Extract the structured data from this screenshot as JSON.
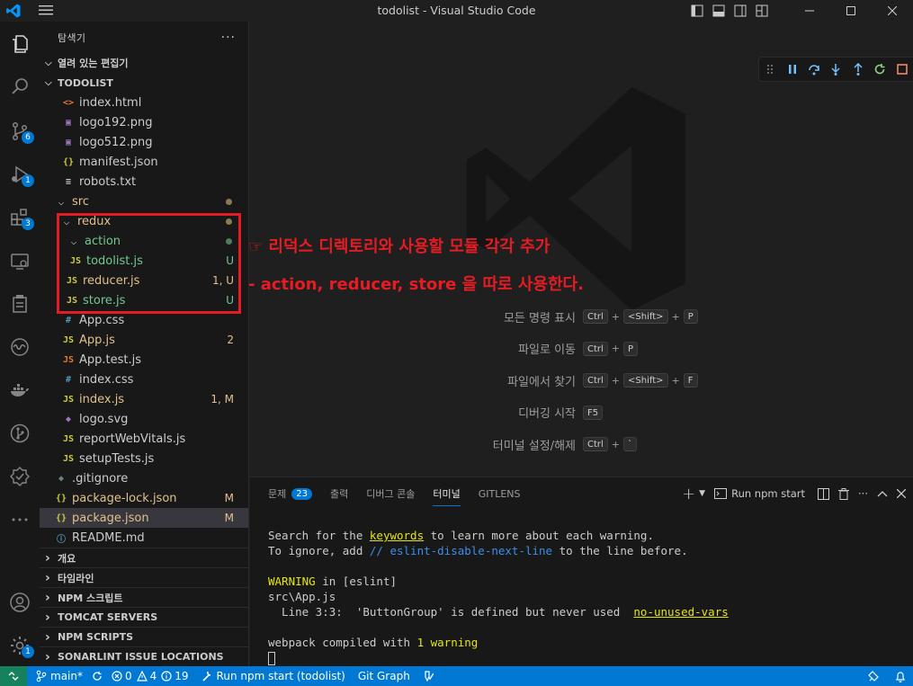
{
  "window": {
    "title": "todolist - Visual Studio Code"
  },
  "activity_bar": {
    "items": [
      {
        "name": "explorer",
        "badge": ""
      },
      {
        "name": "search",
        "badge": ""
      },
      {
        "name": "source-control",
        "badge": "6"
      },
      {
        "name": "run-debug",
        "badge": "1"
      },
      {
        "name": "extensions",
        "badge": "3"
      },
      {
        "name": "remote-explorer",
        "badge": ""
      },
      {
        "name": "testing",
        "badge": ""
      },
      {
        "name": "timeline-wave",
        "badge": ""
      },
      {
        "name": "docker",
        "badge": ""
      },
      {
        "name": "git-graph",
        "badge": ""
      },
      {
        "name": "sonarlint",
        "badge": ""
      },
      {
        "name": "more",
        "badge": ""
      }
    ],
    "accounts_badge": "",
    "settings_badge": "1"
  },
  "sidebar": {
    "header": "탐색기",
    "open_editors": "열려 있는 편집기",
    "project": "TODOLIST",
    "files": [
      {
        "label": "index.html",
        "icon": "<>",
        "color": "#e37933",
        "indent": 1,
        "status": "",
        "label_class": ""
      },
      {
        "label": "logo192.png",
        "icon": "▣",
        "color": "#a074c4",
        "indent": 1,
        "status": "",
        "label_class": ""
      },
      {
        "label": "logo512.png",
        "icon": "▣",
        "color": "#a074c4",
        "indent": 1,
        "status": "",
        "label_class": ""
      },
      {
        "label": "manifest.json",
        "icon": "{}",
        "color": "#cbcb41",
        "indent": 1,
        "status": "",
        "label_class": ""
      },
      {
        "label": "robots.txt",
        "icon": "≡",
        "color": "#cccccc",
        "indent": 1,
        "status": "",
        "label_class": ""
      },
      {
        "label": "src",
        "icon": "chev-down",
        "color": "#cccccc",
        "indent": 0,
        "status": "dot-mod",
        "label_class": "c-mod"
      },
      {
        "label": "redux",
        "icon": "chev-down",
        "color": "#cccccc",
        "indent": 1,
        "status": "dot-mod",
        "label_class": "c-mod"
      },
      {
        "label": "action",
        "icon": "chev-down",
        "color": "#cccccc",
        "indent": 2,
        "status": "dot-new",
        "label_class": "c-new"
      },
      {
        "label": "todolist.js",
        "icon": "JS",
        "color": "#cbcb41",
        "indent": 3,
        "status": "U",
        "label_class": "c-new"
      },
      {
        "label": "reducer.js",
        "icon": "JS",
        "color": "#cbcb41",
        "indent": 2,
        "status": "1, U",
        "label_class": "c-err"
      },
      {
        "label": "store.js",
        "icon": "JS",
        "color": "#cbcb41",
        "indent": 2,
        "status": "U",
        "label_class": "c-new"
      },
      {
        "label": "App.css",
        "icon": "#",
        "color": "#519aba",
        "indent": 1,
        "status": "",
        "label_class": ""
      },
      {
        "label": "App.js",
        "icon": "JS",
        "color": "#cbcb41",
        "indent": 1,
        "status": "2",
        "label_class": "c-err"
      },
      {
        "label": "App.test.js",
        "icon": "JS",
        "color": "#e37933",
        "indent": 1,
        "status": "",
        "label_class": ""
      },
      {
        "label": "index.css",
        "icon": "#",
        "color": "#519aba",
        "indent": 1,
        "status": "",
        "label_class": ""
      },
      {
        "label": "index.js",
        "icon": "JS",
        "color": "#cbcb41",
        "indent": 1,
        "status": "1, M",
        "label_class": "c-err"
      },
      {
        "label": "logo.svg",
        "icon": "◆",
        "color": "#a074c4",
        "indent": 1,
        "status": "",
        "label_class": ""
      },
      {
        "label": "reportWebVitals.js",
        "icon": "JS",
        "color": "#cbcb41",
        "indent": 1,
        "status": "",
        "label_class": ""
      },
      {
        "label": "setupTests.js",
        "icon": "JS",
        "color": "#cbcb41",
        "indent": 1,
        "status": "",
        "label_class": ""
      },
      {
        "label": ".gitignore",
        "icon": "◆",
        "color": "#6d8086",
        "indent": 0,
        "status": "",
        "label_class": ""
      },
      {
        "label": "package-lock.json",
        "icon": "{}",
        "color": "#cbcb41",
        "indent": 0,
        "status": "M",
        "label_class": "c-mod"
      },
      {
        "label": "package.json",
        "icon": "{}",
        "color": "#cbcb41",
        "indent": 0,
        "status": "M",
        "label_class": "c-mod",
        "selected": true
      },
      {
        "label": "README.md",
        "icon": "ⓘ",
        "color": "#519aba",
        "indent": 0,
        "status": "",
        "label_class": ""
      }
    ],
    "sections": [
      "개요",
      "타임라인",
      "NPM 스크립트",
      "TOMCAT SERVERS",
      "NPM SCRIPTS",
      "SONARLINT ISSUE LOCATIONS"
    ]
  },
  "annotation": {
    "line1": "☞ 리덕스 디렉토리와 사용할 모듈 각각 추가",
    "line2": "- action, reducer, store 을 따로 사용한다."
  },
  "shortcuts": [
    {
      "label": "모든 명령 표시",
      "keys": [
        "Ctrl",
        "<Shift>",
        "P"
      ]
    },
    {
      "label": "파일로 이동",
      "keys": [
        "Ctrl",
        "P"
      ]
    },
    {
      "label": "파일에서 찾기",
      "keys": [
        "Ctrl",
        "<Shift>",
        "F"
      ]
    },
    {
      "label": "디버깅 시작",
      "keys": [
        "F5"
      ]
    },
    {
      "label": "터미널 설정/해제",
      "keys": [
        "Ctrl",
        "`"
      ]
    }
  ],
  "panel": {
    "tabs": [
      {
        "label": "문제",
        "badge": "23",
        "active": false
      },
      {
        "label": "출력",
        "badge": "",
        "active": false
      },
      {
        "label": "디버그 콘솔",
        "badge": "",
        "active": false
      },
      {
        "label": "터미널",
        "badge": "",
        "active": true
      },
      {
        "label": "GITLENS",
        "badge": "",
        "active": false
      }
    ],
    "task_label": "Run npm start",
    "terminal": {
      "l1_a": "Search for the ",
      "l1_b": "keywords",
      "l1_c": " to learn more about each warning.",
      "l2_a": "To ignore, add ",
      "l2_b": "// eslint-disable-next-line",
      "l2_c": " to the line before.",
      "l4_a": "WARNING",
      "l4_b": " in [eslint]",
      "l5": "src\\App.js",
      "l6_a": "  Line 3:3:  'ButtonGroup' is defined but never used  ",
      "l6_b": "no-unused-vars",
      "l8_a": "webpack compiled with ",
      "l8_b": "1 warning"
    }
  },
  "statusbar": {
    "branch": "main*",
    "errors": "0",
    "warnings": "4",
    "info": "19",
    "task": "Run npm start (todolist)",
    "git_graph": "Git Graph"
  }
}
